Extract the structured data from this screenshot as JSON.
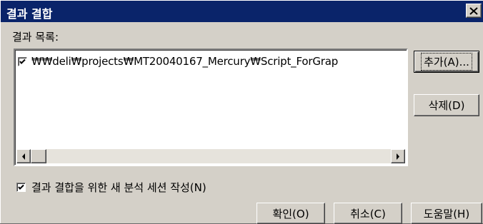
{
  "window": {
    "title": "결과 결합"
  },
  "list": {
    "label": "결과 목록:",
    "items": [
      {
        "checked": true,
        "path": "₩₩deli₩projects₩MT20040167_Mercury₩Script_ForGrap"
      }
    ]
  },
  "buttons": {
    "add": "추가(A)...",
    "delete": "삭제(D)",
    "ok": "확인(O)",
    "cancel": "취소(C)",
    "help": "도움말(H)"
  },
  "option": {
    "checked": true,
    "label": "결과 결합을 위한 새 분석 세션 작성(N)"
  },
  "icons": {
    "close": "close-icon",
    "check": "checkmark-icon",
    "scroll_left": "arrow-left-icon",
    "scroll_right": "arrow-right-icon"
  },
  "colors": {
    "titlebar": "#0a246a",
    "face": "#d4d0c8"
  }
}
